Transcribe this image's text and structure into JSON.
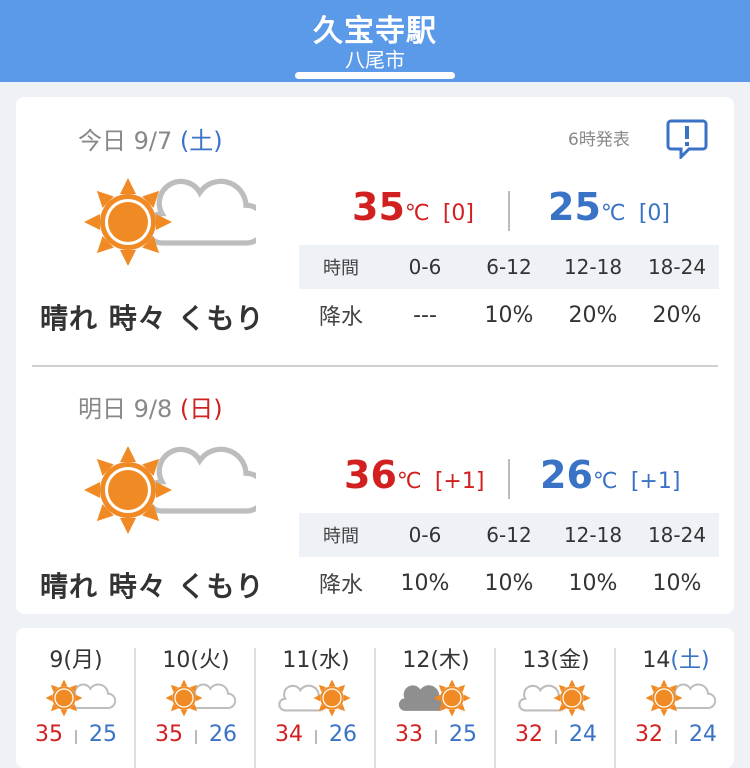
{
  "header": {
    "station": "久宝寺駅",
    "city": "八尾市"
  },
  "today": {
    "date": "今日 9/7",
    "dow": "(土)",
    "announce": "6時発表",
    "weather": "晴れ 時々 くもり",
    "weather_icon": "sun-and-cloud-icon",
    "tmax": "35",
    "tmax_diff": "[0]",
    "tmin": "25",
    "tmin_diff": "[0]",
    "unit": "℃",
    "rain_header": [
      "時間",
      "0-6",
      "6-12",
      "12-18",
      "18-24"
    ],
    "rain_values": [
      "降水",
      "---",
      "10%",
      "20%",
      "20%"
    ]
  },
  "tomorrow": {
    "date": "明日 9/8",
    "dow": "(日)",
    "weather": "晴れ 時々 くもり",
    "weather_icon": "sun-and-cloud-icon",
    "tmax": "36",
    "tmax_diff": "[+1]",
    "tmin": "26",
    "tmin_diff": "[+1]",
    "unit": "℃",
    "rain_header": [
      "時間",
      "0-6",
      "6-12",
      "12-18",
      "18-24"
    ],
    "rain_values": [
      "降水",
      "10%",
      "10%",
      "10%",
      "10%"
    ]
  },
  "weekly": [
    {
      "date": "9",
      "dow": "(月)",
      "icon": "sun-cloud-icon",
      "hi": "35",
      "lo": "25"
    },
    {
      "date": "10",
      "dow": "(火)",
      "icon": "sun-cloud-icon",
      "hi": "35",
      "lo": "26"
    },
    {
      "date": "11",
      "dow": "(水)",
      "icon": "cloud-sun-icon",
      "hi": "34",
      "lo": "26"
    },
    {
      "date": "12",
      "dow": "(木)",
      "icon": "dark-cloud-sun-icon",
      "hi": "33",
      "lo": "25"
    },
    {
      "date": "13",
      "dow": "(金)",
      "icon": "cloud-sun-icon",
      "hi": "32",
      "lo": "24"
    },
    {
      "date": "14",
      "dow": "(土)",
      "icon": "sun-cloud-icon",
      "hi": "32",
      "lo": "24"
    }
  ],
  "colors": {
    "header": "#5b9ae8",
    "max": "#d22020",
    "min": "#3a72c5",
    "sun": "#f08a24"
  }
}
